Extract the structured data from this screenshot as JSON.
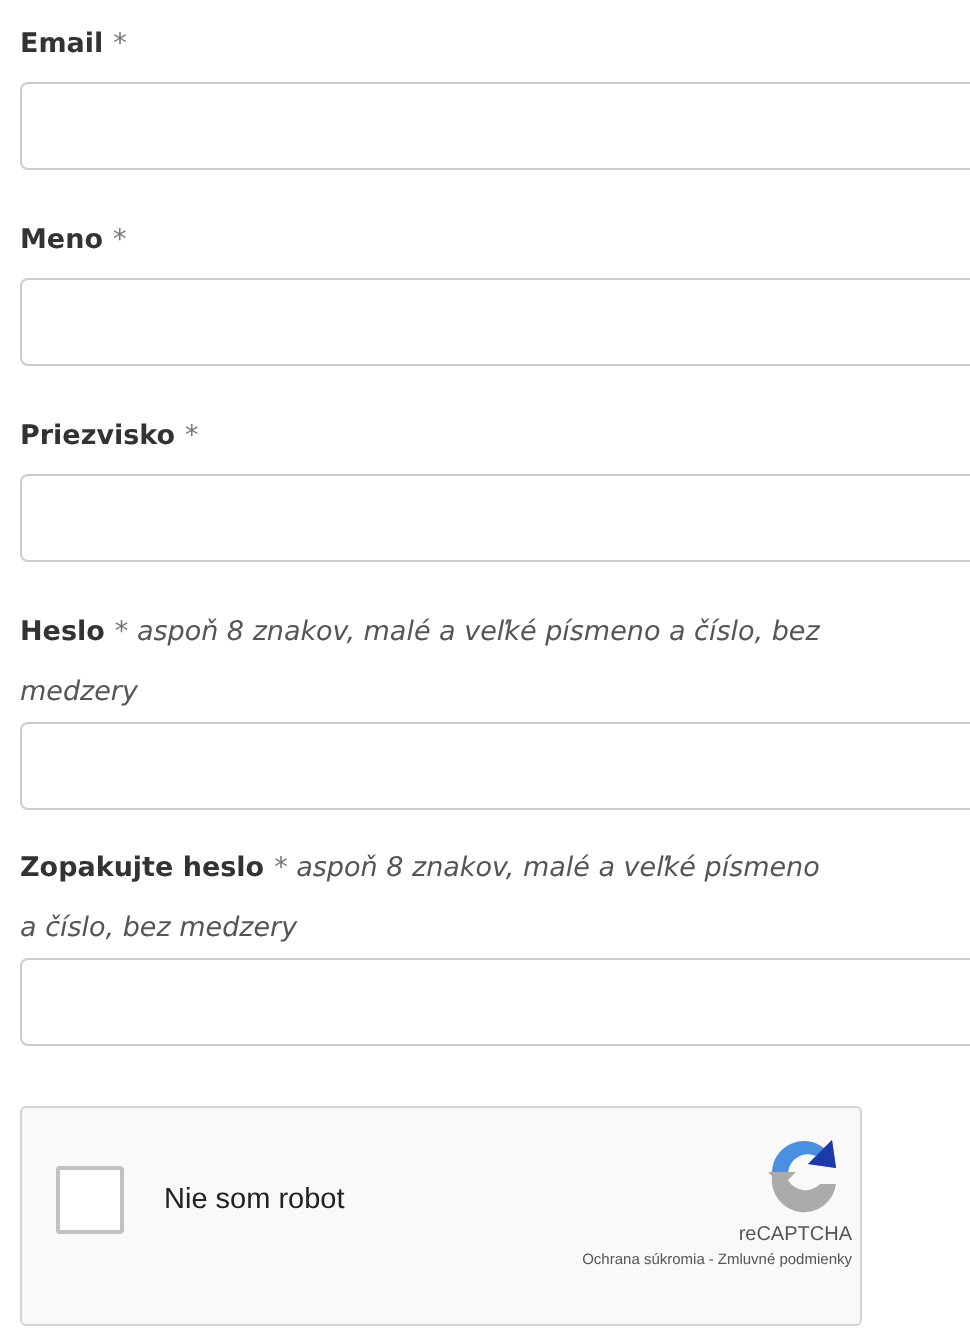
{
  "fields": [
    {
      "label": "Email",
      "required": true
    },
    {
      "label": "Meno",
      "required": true
    },
    {
      "label": "Priezvisko",
      "required": true
    },
    {
      "label": "Heslo",
      "required": true,
      "hint": "aspoň 8 znakov, malé a veľké písmeno a číslo, bez medzery"
    },
    {
      "label": "Zopakujte heslo",
      "required": true,
      "hint": "aspoň 8 znakov, malé a veľké písmeno a číslo, bez medzery"
    }
  ],
  "required_mark": "*",
  "captcha": {
    "label": "Nie som robot",
    "checked": false,
    "brand": "reCAPTCHA",
    "links": [
      "Ochrana súkromia",
      "Zmluvné podmienky"
    ],
    "separator": "-"
  }
}
